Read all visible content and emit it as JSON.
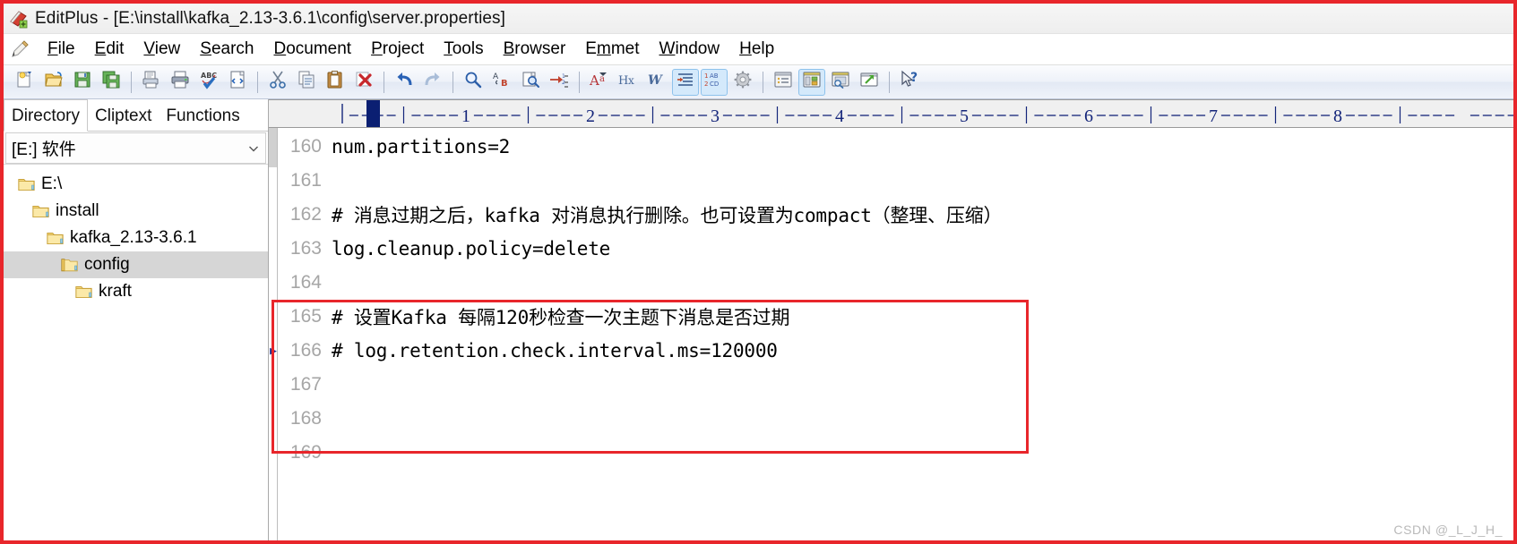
{
  "window": {
    "title": "EditPlus - [E:\\install\\kafka_2.13-3.6.1\\config\\server.properties]",
    "app_icon": "editplus-icon"
  },
  "menubar": {
    "pencil_icon": "pencil-icon",
    "items": [
      {
        "pre": "",
        "key": "F",
        "post": "ile"
      },
      {
        "pre": "",
        "key": "E",
        "post": "dit"
      },
      {
        "pre": "",
        "key": "V",
        "post": "iew"
      },
      {
        "pre": "",
        "key": "S",
        "post": "earch"
      },
      {
        "pre": "",
        "key": "D",
        "post": "ocument"
      },
      {
        "pre": "",
        "key": "P",
        "post": "roject"
      },
      {
        "pre": "",
        "key": "T",
        "post": "ools"
      },
      {
        "pre": "",
        "key": "B",
        "post": "rowser"
      },
      {
        "pre": "E",
        "key": "m",
        "post": "met"
      },
      {
        "pre": "",
        "key": "W",
        "post": "indow"
      },
      {
        "pre": "",
        "key": "H",
        "post": "elp"
      }
    ]
  },
  "toolbar": {
    "buttons": [
      {
        "icon": "new-file-icon",
        "active": false
      },
      {
        "icon": "open-folder-icon",
        "active": false
      },
      {
        "icon": "save-icon",
        "active": false
      },
      {
        "icon": "save-all-icon",
        "active": false
      },
      {
        "sep": true
      },
      {
        "icon": "print-preview-icon",
        "active": false
      },
      {
        "icon": "print-icon",
        "active": false
      },
      {
        "icon": "spell-check-icon",
        "active": false
      },
      {
        "icon": "view-source-icon",
        "active": false
      },
      {
        "sep": true
      },
      {
        "icon": "cut-icon",
        "active": false
      },
      {
        "icon": "copy-icon",
        "active": false
      },
      {
        "icon": "paste-icon",
        "active": false
      },
      {
        "icon": "delete-icon",
        "active": false
      },
      {
        "sep": true
      },
      {
        "icon": "undo-icon",
        "active": false
      },
      {
        "icon": "redo-icon",
        "active": false
      },
      {
        "sep": true
      },
      {
        "icon": "find-icon",
        "active": false
      },
      {
        "icon": "replace-icon",
        "active": false
      },
      {
        "icon": "find-in-files-icon",
        "active": false
      },
      {
        "icon": "goto-line-icon",
        "active": false
      },
      {
        "sep": true
      },
      {
        "icon": "font-icon",
        "active": false
      },
      {
        "icon": "hex-icon",
        "active": false
      },
      {
        "icon": "word-wrap-icon",
        "active": false
      },
      {
        "icon": "indent-icon",
        "active": true
      },
      {
        "icon": "line-numbers-icon",
        "active": true
      },
      {
        "icon": "preferences-icon",
        "active": false
      },
      {
        "sep": true
      },
      {
        "icon": "document-selector-icon",
        "active": false
      },
      {
        "icon": "toggle-window-icon",
        "active": true
      },
      {
        "icon": "browser-preview-icon",
        "active": false
      },
      {
        "icon": "open-external-icon",
        "active": false
      },
      {
        "sep": true
      },
      {
        "icon": "help-cursor-icon",
        "active": false
      }
    ]
  },
  "dock": {
    "tabs": [
      {
        "label": "Directory",
        "selected": true
      },
      {
        "label": "Cliptext",
        "selected": false
      },
      {
        "label": "Functions",
        "selected": false
      }
    ],
    "drive_selector": {
      "value": "[E:] 软件",
      "chevron_icon": "chevron-down-icon"
    },
    "tree": [
      {
        "label": "E:\\",
        "indent": 0,
        "selected": false,
        "icon": "folder-icon"
      },
      {
        "label": "install",
        "indent": 1,
        "selected": false,
        "icon": "folder-icon"
      },
      {
        "label": "kafka_2.13-3.6.1",
        "indent": 2,
        "selected": false,
        "icon": "folder-icon"
      },
      {
        "label": "config",
        "indent": 3,
        "selected": true,
        "icon": "folder-open-icon"
      },
      {
        "label": "kraft",
        "indent": 4,
        "selected": false,
        "icon": "folder-icon"
      }
    ]
  },
  "editor": {
    "ruler": {
      "numbers": [
        "1",
        "2",
        "3",
        "4",
        "5",
        "6",
        "7",
        "8"
      ],
      "caret_column": 1
    },
    "lines": [
      {
        "no": "160",
        "text": "num.partitions=2",
        "marker": "",
        "highlighted": false
      },
      {
        "no": "161",
        "text": "",
        "marker": "",
        "highlighted": false
      },
      {
        "no": "162",
        "text": "# 消息过期之后，kafka 对消息执行删除。也可设置为compact（整理、压缩）",
        "marker": "",
        "highlighted": false
      },
      {
        "no": "163",
        "text": "log.cleanup.policy=delete",
        "marker": "",
        "highlighted": false
      },
      {
        "no": "164",
        "text": "",
        "marker": "",
        "highlighted": true
      },
      {
        "no": "165",
        "text": "# 设置Kafka 每隔120秒检查一次主题下消息是否过期",
        "marker": "",
        "highlighted": true
      },
      {
        "no": "166",
        "text": "# log.retention.check.interval.ms=120000",
        "marker": "▶",
        "highlighted": true
      },
      {
        "no": "167",
        "text": "",
        "marker": "",
        "highlighted": true
      },
      {
        "no": "168",
        "text": "",
        "marker": "",
        "highlighted": true
      },
      {
        "no": "169",
        "text": "",
        "marker": "",
        "highlighted": false
      }
    ]
  },
  "watermark": {
    "text": "CSDN @_L_J_H_"
  },
  "colors": {
    "annotation_red": "#e8262b",
    "ruler_blue": "#0b1f72",
    "selection_gray": "#d6d6d6",
    "linenumber_gray": "#a6a6a6",
    "toolbar_active": "#d4e9fb"
  }
}
